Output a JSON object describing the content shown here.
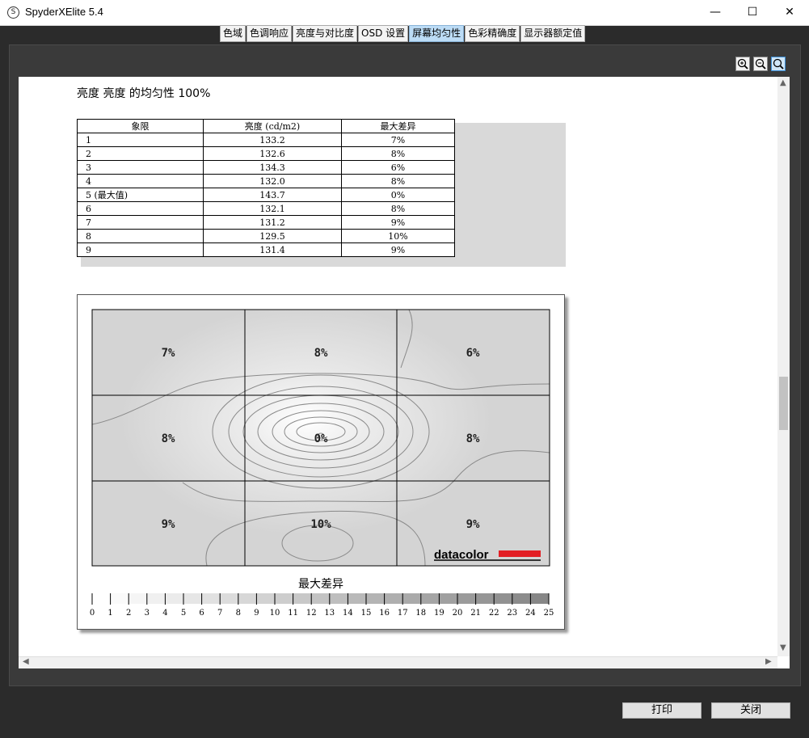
{
  "window": {
    "title": "SpyderXElite 5.4",
    "icon_glyph": "S",
    "controls": {
      "minimize": "—",
      "maximize": "☐",
      "close": "✕"
    }
  },
  "tabs": [
    {
      "label": "色域",
      "active": false
    },
    {
      "label": "色调响应",
      "active": false
    },
    {
      "label": "亮度与对比度",
      "active": false
    },
    {
      "label": "OSD 设置",
      "active": false
    },
    {
      "label": "屏幕均匀性",
      "active": true
    },
    {
      "label": "色彩精确度",
      "active": false
    },
    {
      "label": "显示器额定值",
      "active": false
    }
  ],
  "zoom_icons": [
    "zoom-in-icon",
    "zoom-out-icon",
    "zoom-fit-icon"
  ],
  "report": {
    "heading": "亮度 亮度 的均匀性 100%",
    "table": {
      "headers": [
        "象限",
        "亮度 (cd/m2)",
        "最大差异"
      ],
      "rows": [
        [
          "1",
          "133.2",
          "7%"
        ],
        [
          "2",
          "132.6",
          "8%"
        ],
        [
          "3",
          "134.3",
          "6%"
        ],
        [
          "4",
          "132.0",
          "8%"
        ],
        [
          "5 (最大值)",
          "143.7",
          "0%"
        ],
        [
          "6",
          "132.1",
          "8%"
        ],
        [
          "7",
          "131.2",
          "9%"
        ],
        [
          "8",
          "129.5",
          "10%"
        ],
        [
          "9",
          "131.4",
          "9%"
        ]
      ]
    },
    "map": {
      "cells": [
        "7%",
        "8%",
        "6%",
        "8%",
        "0%",
        "8%",
        "9%",
        "10%",
        "9%"
      ],
      "legend_title": "最大差异",
      "scale_labels": [
        "0",
        "1",
        "2",
        "3",
        "4",
        "5",
        "6",
        "7",
        "8",
        "9",
        "10",
        "11",
        "12",
        "13",
        "14",
        "15",
        "16",
        "17",
        "18",
        "19",
        "20",
        "21",
        "22",
        "23",
        "24",
        "25"
      ],
      "logo_text": "datacolor"
    }
  },
  "colors": {
    "active_tab": "#bcdcf6",
    "logo_red": "#e31e24",
    "map_gray": "#d6d6d6"
  },
  "buttons": {
    "print": "打印",
    "close": "关闭"
  }
}
